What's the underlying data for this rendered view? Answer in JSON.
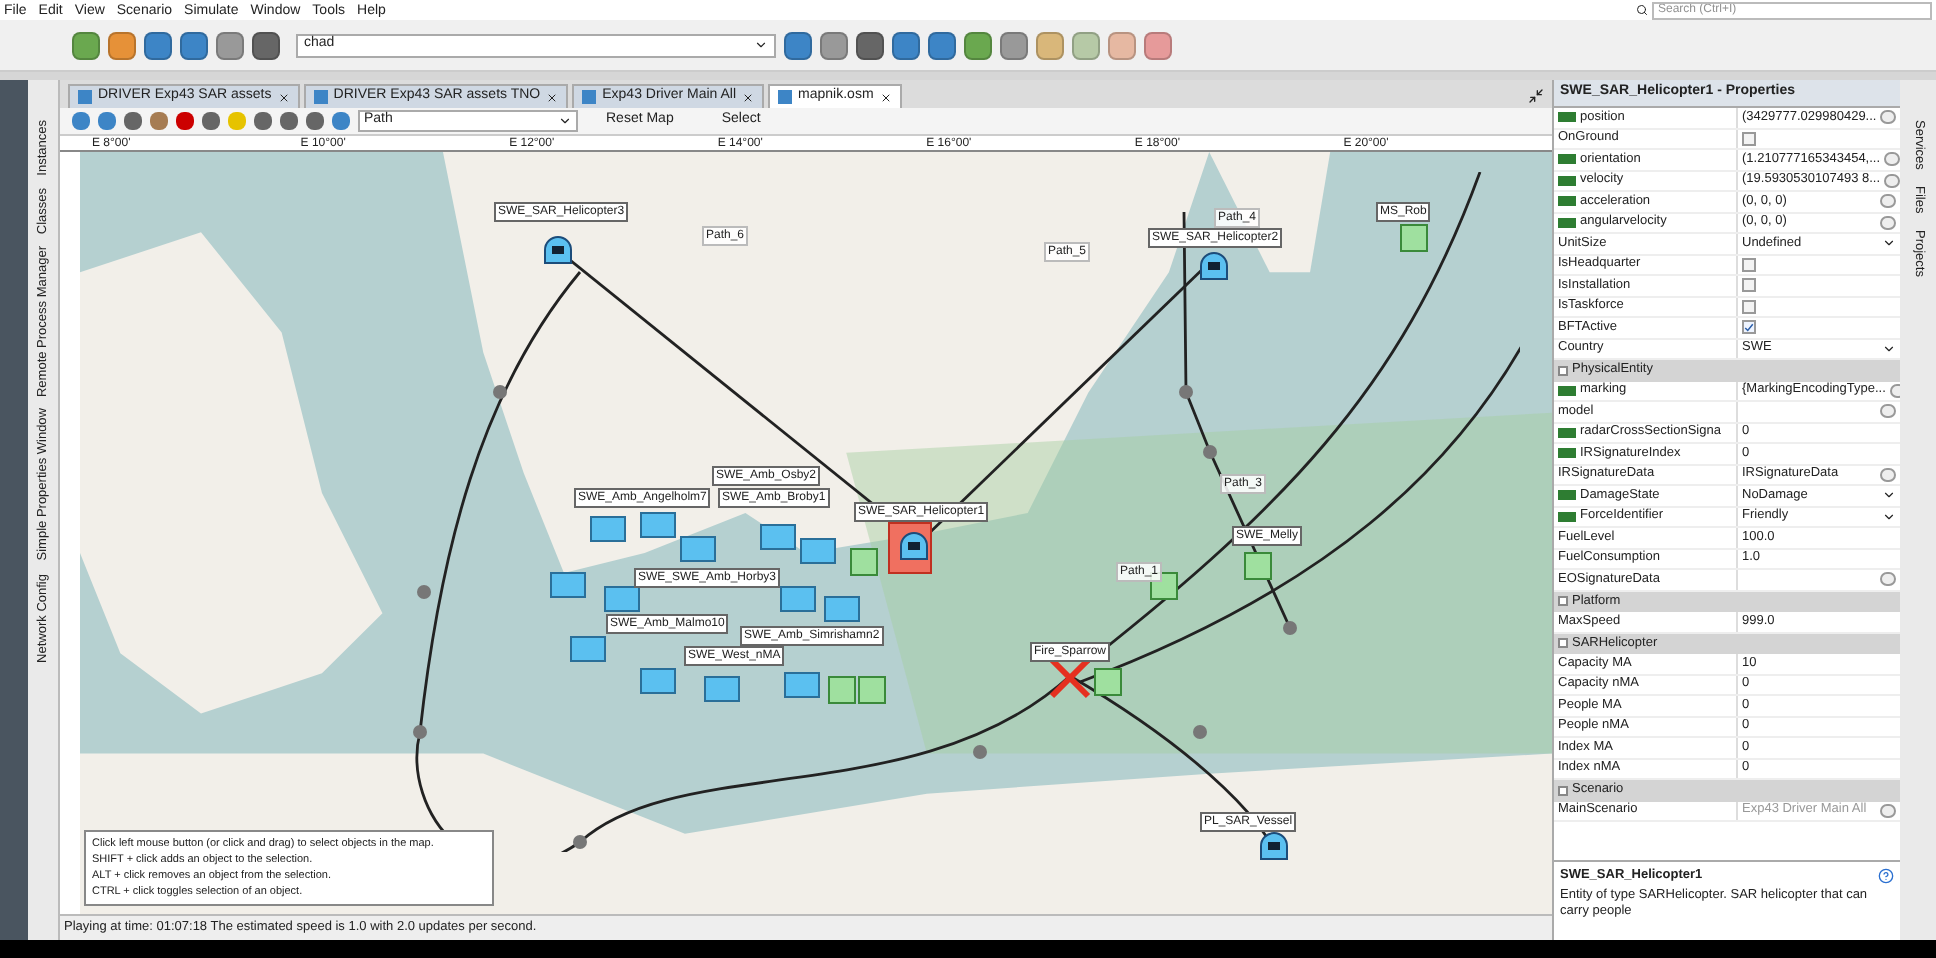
{
  "menu": [
    "File",
    "Edit",
    "View",
    "Scenario",
    "Simulate",
    "Window",
    "Tools",
    "Help"
  ],
  "search": {
    "placeholder": "Search (Ctrl+I)"
  },
  "toolbar": {
    "scenario_select": "chad"
  },
  "side_tabs_left": [
    "Instances",
    "Classes",
    "Remote Process Manager",
    "Simple Properties Window",
    "Network Config"
  ],
  "tabs": [
    {
      "label": "DRIVER Exp43 SAR assets",
      "selected": false
    },
    {
      "label": "DRIVER Exp43 SAR assets TNO",
      "selected": false
    },
    {
      "label": "Exp43 Driver Main All",
      "selected": false
    },
    {
      "label": "mapnik.osm",
      "selected": true
    }
  ],
  "map_toolbar": {
    "tool_select": "Path",
    "buttons": [
      "Reset Map",
      "Select"
    ]
  },
  "ruler": [
    "E 8°00'",
    "E 10°00'",
    "E 12°00'",
    "E 14°00'",
    "E 16°00'",
    "E 18°00'",
    "E 20°00'"
  ],
  "map_labels": [
    {
      "text": "SWE_SAR_Helicopter3",
      "kind": "entity"
    },
    {
      "text": "Path_6",
      "kind": "path"
    },
    {
      "text": "Path_5",
      "kind": "path"
    },
    {
      "text": "Path_4",
      "kind": "path"
    },
    {
      "text": "SWE_SAR_Helicopter2",
      "kind": "entity"
    },
    {
      "text": "MS_Rob",
      "kind": "entity"
    },
    {
      "text": "SWE_Amb_Osby2",
      "kind": "entity"
    },
    {
      "text": "SWE_Amb_Angelholm7",
      "kind": "entity"
    },
    {
      "text": "SWE_Amb_Broby1",
      "kind": "entity"
    },
    {
      "text": "SWE_SAR_Helicopter1",
      "kind": "entity"
    },
    {
      "text": "Path_3",
      "kind": "path"
    },
    {
      "text": "SWE_Melly",
      "kind": "entity"
    },
    {
      "text": "Path_1",
      "kind": "path"
    },
    {
      "text": "SWE_SWE_Amb_Horby3",
      "kind": "entity"
    },
    {
      "text": "SWE_Amb_Malmo10",
      "kind": "entity"
    },
    {
      "text": "SWE_Amb_Simrishamn2",
      "kind": "entity"
    },
    {
      "text": "SWE_West_nMA",
      "kind": "entity"
    },
    {
      "text": "Fire_Sparrow",
      "kind": "entity"
    },
    {
      "text": "PL_SAR_Vessel",
      "kind": "entity"
    }
  ],
  "map_help": [
    "Click left mouse button (or click and drag) to select objects in the map.",
    "SHIFT + click adds an object to the selection.",
    "ALT + click removes an object from the selection.",
    "CTRL + click toggles selection of an object."
  ],
  "status_bar": "Playing at time: 01:07:18 The estimated speed is 1.0 with 2.0 updates per second.",
  "properties": {
    "title": "SWE_SAR_Helicopter1 - Properties",
    "rows": [
      {
        "kind": "text",
        "name": "position",
        "hla": true,
        "value": "(3429777.029980429...",
        "ellipsis": true
      },
      {
        "kind": "check",
        "name": "OnGround",
        "hla": false,
        "checked": false
      },
      {
        "kind": "text",
        "name": "orientation",
        "hla": true,
        "value": "(1.210777165343454,...",
        "ellipsis": true
      },
      {
        "kind": "text",
        "name": "velocity",
        "hla": true,
        "value": "(19.5930530107493 8...",
        "ellipsis": true
      },
      {
        "kind": "text",
        "name": "acceleration",
        "hla": true,
        "value": "(0, 0, 0)",
        "ellipsis": true
      },
      {
        "kind": "text",
        "name": "angularvelocity",
        "hla": true,
        "value": "(0, 0, 0)",
        "ellipsis": true
      },
      {
        "kind": "select",
        "name": "UnitSize",
        "hla": false,
        "value": "Undefined"
      },
      {
        "kind": "check",
        "name": "IsHeadquarter",
        "hla": false,
        "checked": false
      },
      {
        "kind": "check",
        "name": "IsInstallation",
        "hla": false,
        "checked": false
      },
      {
        "kind": "check",
        "name": "IsTaskforce",
        "hla": false,
        "checked": false
      },
      {
        "kind": "check",
        "name": "BFTActive",
        "hla": false,
        "checked": true
      },
      {
        "kind": "select",
        "name": "Country",
        "hla": false,
        "value": "SWE"
      },
      {
        "kind": "section",
        "name": "PhysicalEntity"
      },
      {
        "kind": "text",
        "name": "marking",
        "hla": true,
        "value": "{MarkingEncodingType...",
        "ellipsis": true
      },
      {
        "kind": "text",
        "name": "model",
        "hla": false,
        "ellipsis": true
      },
      {
        "kind": "text",
        "name": "radarCrossSectionSigna",
        "hla": true,
        "value": "0",
        "ellipsis": false
      },
      {
        "kind": "text",
        "name": "IRSignatureIndex",
        "hla": true,
        "value": "0",
        "ellipsis": false
      },
      {
        "kind": "text",
        "name": "IRSignatureData",
        "hla": false,
        "value": "IRSignatureData",
        "ellipsis": true
      },
      {
        "kind": "select",
        "name": "DamageState",
        "hla": true,
        "value": "NoDamage"
      },
      {
        "kind": "select",
        "name": "ForceIdentifier",
        "hla": true,
        "value": "Friendly"
      },
      {
        "kind": "text",
        "name": "FuelLevel",
        "hla": false,
        "value": "100.0",
        "ellipsis": false
      },
      {
        "kind": "text",
        "name": "FuelConsumption",
        "hla": false,
        "value": "1.0",
        "ellipsis": false
      },
      {
        "kind": "text",
        "name": "EOSignatureData",
        "hla": false,
        "ellipsis": true
      },
      {
        "kind": "section",
        "name": "Platform"
      },
      {
        "kind": "text",
        "name": "MaxSpeed",
        "hla": false,
        "value": "999.0",
        "ellipsis": false
      },
      {
        "kind": "section",
        "name": "SARHelicopter"
      },
      {
        "kind": "text",
        "name": "Capacity MA",
        "hla": false,
        "value": "10",
        "ellipsis": false
      },
      {
        "kind": "text",
        "name": "Capacity nMA",
        "hla": false,
        "value": "0",
        "ellipsis": false
      },
      {
        "kind": "text",
        "name": "People MA",
        "hla": false,
        "value": "0",
        "ellipsis": false
      },
      {
        "kind": "text",
        "name": "People nMA",
        "hla": false,
        "value": "0",
        "ellipsis": false
      },
      {
        "kind": "text",
        "name": "Index MA",
        "hla": false,
        "value": "0",
        "ellipsis": false
      },
      {
        "kind": "text",
        "name": "Index nMA",
        "hla": false,
        "value": "0",
        "ellipsis": false
      },
      {
        "kind": "section",
        "name": "Scenario"
      },
      {
        "kind": "text",
        "name": "MainScenario",
        "hla": false,
        "value": "Exp43 Driver Main All",
        "ellipsis": true,
        "disabled": true
      }
    ],
    "description": {
      "title": "SWE_SAR_Helicopter1",
      "text": "Entity of type SARHelicopter. SAR helicopter that can carry people"
    }
  },
  "side_tabs_right": [
    "Services",
    "Files",
    "Projects"
  ]
}
